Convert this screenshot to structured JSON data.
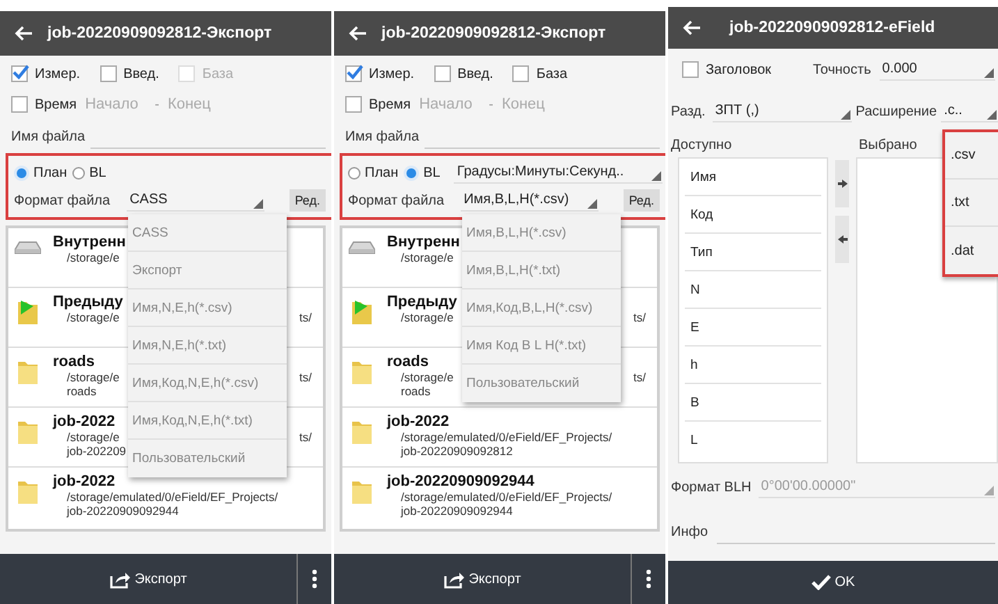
{
  "export_screens": [
    {
      "title": "job-20220909092812-Экспорт",
      "checks": [
        {
          "label": "Измер.",
          "checked": true,
          "disabled": false
        },
        {
          "label": "Введ.",
          "checked": false,
          "disabled": false
        },
        {
          "label": "База",
          "checked": false,
          "disabled": true
        }
      ],
      "time": {
        "label": "Время",
        "checked": false
      },
      "start_placeholder": "Начало",
      "range_separator": "-",
      "end_placeholder": "Конец",
      "file_name_label": "Имя файла",
      "coord_modes": [
        {
          "label": "План",
          "selected": true
        },
        {
          "label": "BL",
          "selected": false
        }
      ],
      "format_label": "Формат файла",
      "format_value": "CASS",
      "edit_button": "Ред.",
      "files": [
        {
          "kind": "drive",
          "name": "Внутренн",
          "path": "/storage/e"
        },
        {
          "kind": "folder_green",
          "name": "Предыду",
          "path": "/storage/e",
          "tail": "ts/"
        },
        {
          "kind": "folder",
          "name": "roads",
          "path": "/storage/e",
          "tail": "ts/",
          "path_2": "roads"
        },
        {
          "kind": "folder",
          "name": "job-2022",
          "path": "/storage/e",
          "tail": "ts/",
          "path_2": "job-202209"
        },
        {
          "kind": "folder",
          "name": "job-2022",
          "path": "/storage/emulated/0/eField/EF_Projects/",
          "path_2": "job-20220909092944"
        }
      ],
      "menu": [
        "CASS",
        "Экспорт",
        "Имя,N,E,h(*.csv)",
        "Имя,N,E,h(*.txt)",
        "Имя,Код,N,E,h(*.csv)",
        "Имя,Код,N,E,h(*.txt)",
        "Пользовательский"
      ],
      "export_button": "Экспорт"
    },
    {
      "title": "job-20220909092812-Экспорт",
      "checks": [
        {
          "label": "Измер.",
          "checked": true,
          "disabled": false
        },
        {
          "label": "Введ.",
          "checked": false,
          "disabled": false
        },
        {
          "label": "База",
          "checked": false,
          "disabled": false
        }
      ],
      "time": {
        "label": "Время",
        "checked": false
      },
      "start_placeholder": "Начало",
      "range_separator": "-",
      "end_placeholder": "Конец",
      "file_name_label": "Имя файла",
      "coord_modes": [
        {
          "label": "План",
          "selected": false
        },
        {
          "label": "BL",
          "selected": true
        }
      ],
      "angle_format": "Градусы:Минуты:Секунд..",
      "format_label": "Формат файла",
      "format_value": "Имя,B,L,H(*.csv)",
      "edit_button": "Ред.",
      "files": [
        {
          "kind": "drive",
          "name": "Внутренн",
          "path": "/storage/e"
        },
        {
          "kind": "folder_green",
          "name": "Предыду",
          "path": "/storage/e",
          "tail": "ts/"
        },
        {
          "kind": "folder",
          "name": "roads",
          "path": "/storage/e",
          "tail": "ts/",
          "path_2": "roads"
        },
        {
          "kind": "folder",
          "name": "job-2022",
          "path": "/storage/emulated/0/eField/EF_Projects/",
          "path_2": "job-20220909092812"
        },
        {
          "kind": "folder",
          "name": "job-20220909092944",
          "path": "/storage/emulated/0/eField/EF_Projects/",
          "path_2": "job-20220909092944"
        }
      ],
      "menu": [
        "Имя,B,L,H(*.csv)",
        "Имя,B,L,H(*.txt)",
        "Имя,Код,B,L,H(*.csv)",
        "Имя Код B L H(*.txt)",
        "Пользовательский"
      ],
      "export_button": "Экспорт"
    }
  ],
  "field_screen": {
    "title": "job-20220909092812-eField",
    "header": {
      "label": "Заголовок",
      "checked": false
    },
    "precision_label": "Точность",
    "precision_value": "0.000",
    "separator_label": "Разд.",
    "separator_value": "ЗПТ (,)",
    "extension_label": "Расширение",
    "extension_value": ".c..",
    "available_label": "Доступно",
    "selected_label": "Выбрано",
    "available": [
      "Имя",
      "Код",
      "Тип",
      "N",
      "E",
      "h",
      "B",
      "L"
    ],
    "extension_menu": [
      ".csv",
      ".txt",
      ".dat"
    ],
    "blh_label": "Формат BLH",
    "blh_value": "0°00'00.00000\"",
    "info_label": "Инфо",
    "ok_button": "OK"
  }
}
